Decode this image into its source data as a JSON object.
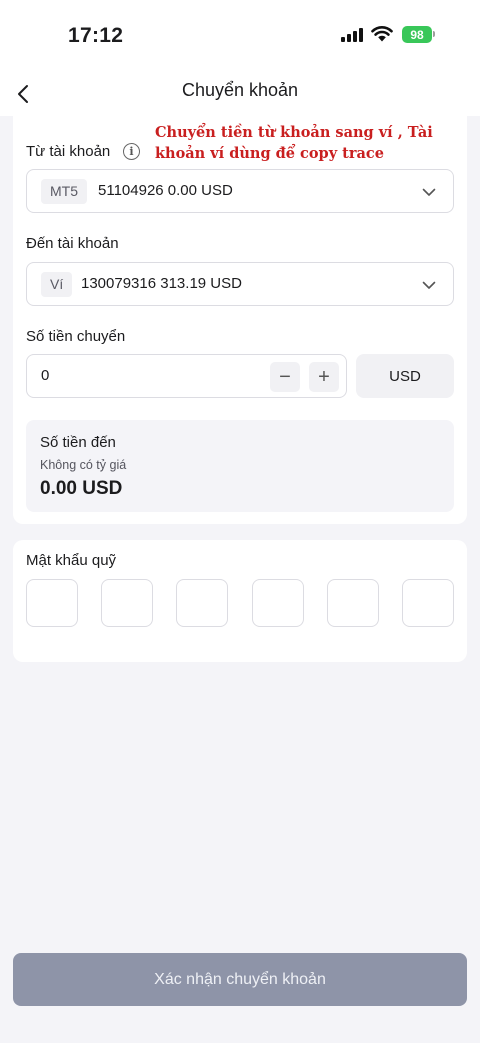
{
  "status_bar": {
    "time": "17:12",
    "battery": "98"
  },
  "nav": {
    "title": "Chuyển khoản",
    "back_icon": "chevron-left-icon"
  },
  "annotation": {
    "text": "Chuyển tiền từ khoản sang ví , Tài khoản ví dùng để copy trace",
    "color": "#c91f1f"
  },
  "from_account": {
    "label": "Từ tài khoản",
    "info_icon": "info-icon",
    "tag": "MT5",
    "value": "51104926 0.00 USD"
  },
  "to_account": {
    "label": "Đến tài khoản",
    "tag": "Ví",
    "value": "130079316 313.19 USD"
  },
  "transfer_amount": {
    "label": "Số tiền chuyển",
    "value": "0",
    "decrement": "−",
    "increment": "+",
    "currency": "USD"
  },
  "received_amount": {
    "label": "Số tiền đến",
    "note": "Không có tỷ giá",
    "value": "0.00 USD"
  },
  "fund_password": {
    "label": "Mật khẩu quỹ",
    "digits": 6
  },
  "confirm": {
    "label": "Xác nhận chuyển khoản",
    "color": "#8e94a8"
  }
}
